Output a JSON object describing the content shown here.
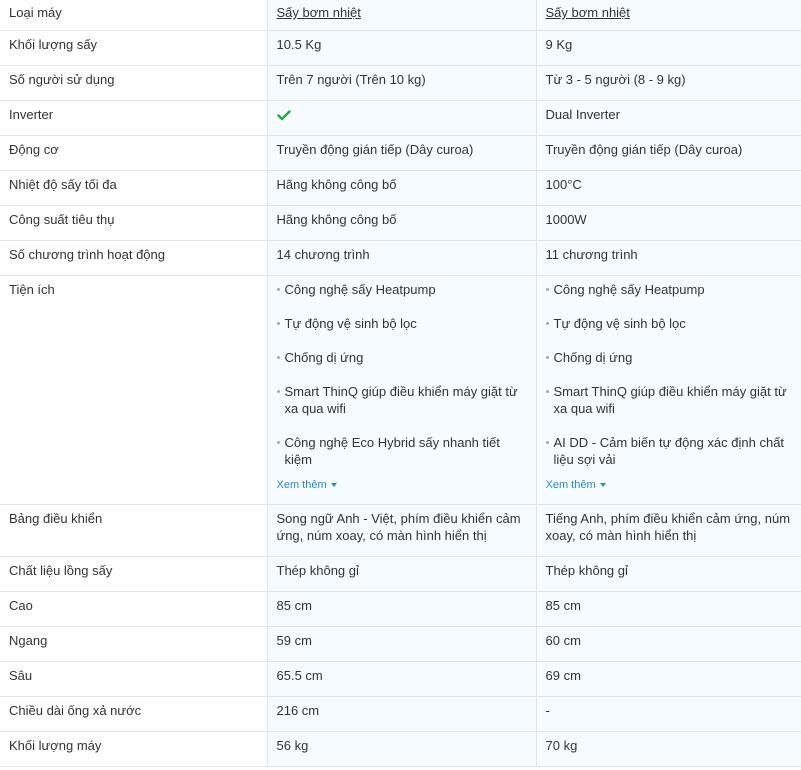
{
  "header": {
    "label": "Loại máy",
    "product_a": "Sấy bơm nhiệt",
    "product_b": "Sấy bơm nhiệt"
  },
  "rows": [
    {
      "label": "Khối lượng sấy",
      "a": "10.5 Kg",
      "b": "9 Kg"
    },
    {
      "label": "Số người sử dụng",
      "a": "Trên 7 người (Trên 10 kg)",
      "b": "Từ 3 - 5 người (8 - 9 kg)"
    },
    {
      "label": "Inverter",
      "a_icon": "check-icon",
      "b": "Dual Inverter"
    },
    {
      "label": "Động cơ",
      "a": "Truyền động gián tiếp (Dây curoa)",
      "b": "Truyền động gián tiếp (Dây curoa)"
    },
    {
      "label": "Nhiệt độ sấy tối đa",
      "a": "Hãng không công bố",
      "b": "100°C"
    },
    {
      "label": "Công suất tiêu thụ",
      "a": "Hãng không công bố",
      "b": "1000W"
    },
    {
      "label": "Số chương trình hoạt động",
      "a": "14 chương trình",
      "b": "11 chương trình"
    }
  ],
  "features": {
    "label": "Tiện ích",
    "a": [
      "Công nghệ sấy Heatpump",
      "Tự động vệ sinh bộ lọc",
      "Chống dị ứng",
      "Smart ThinQ giúp điều khiển máy giặt từ xa qua wifi",
      "Công nghệ Eco Hybrid sấy nhanh tiết kiệm"
    ],
    "b": [
      "Công nghệ sấy Heatpump",
      "Tự động vệ sinh bộ lọc",
      "Chống dị ứng",
      "Smart ThinQ giúp điều khiển máy giặt từ xa qua wifi",
      "AI DD - Cảm biến tự động xác định chất liệu sợi vải"
    ],
    "more_label": "Xem thêm"
  },
  "panel": {
    "label": "Bảng điều khiển",
    "a": "Song ngữ Anh - Việt, phím điều khiển cảm ứng, núm xoay, có màn hình hiển thị",
    "b": "Tiếng Anh, phím điều khiển cảm ứng, núm xoay, có màn hình hiển thị"
  },
  "rows2": [
    {
      "label": "Chất liệu lồng sấy",
      "a": "Thép không gỉ",
      "b": "Thép không gỉ"
    },
    {
      "label": "Cao",
      "a": "85 cm",
      "b": "85 cm"
    },
    {
      "label": "Ngang",
      "a": "59 cm",
      "b": "60 cm"
    },
    {
      "label": "Sâu",
      "a": "65.5 cm",
      "b": "69 cm"
    },
    {
      "label": "Chiều dài ống xả nước",
      "a": "216 cm",
      "b": "-"
    },
    {
      "label": "Khối lượng máy",
      "a": "56 kg",
      "b": "70 kg"
    }
  ],
  "colors": {
    "check": "#2ba84a",
    "link_blue": "#288ad6",
    "cell_bg": "#f5fbfe",
    "border": "#e4e4e4"
  }
}
